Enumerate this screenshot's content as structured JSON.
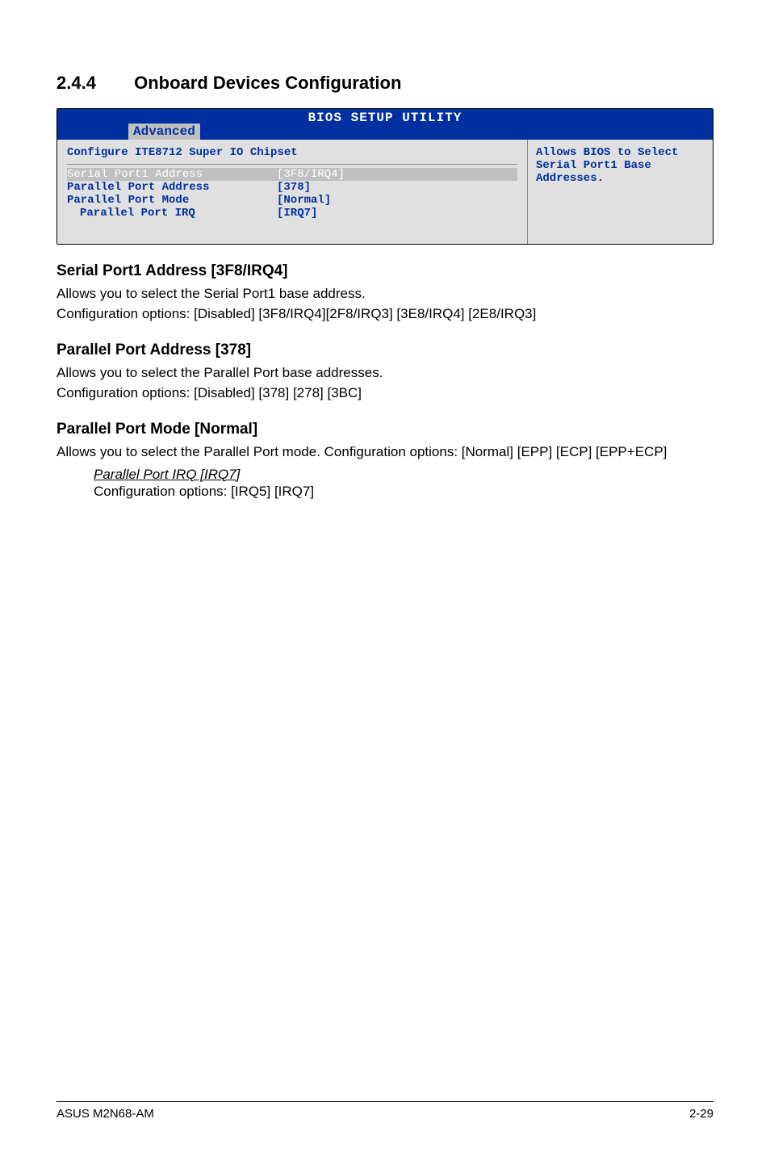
{
  "section": {
    "number": "2.4.4",
    "title": "Onboard Devices Configuration"
  },
  "bios": {
    "header_title": "BIOS SETUP UTILITY",
    "tab": "Advanced",
    "panel_title": "Configure ITE8712 Super IO Chipset",
    "help_text": "Allows BIOS to Select Serial Port1 Base Addresses.",
    "options": [
      {
        "label": "Serial Port1 Address",
        "value": "[3F8/IRQ4]",
        "selected": true,
        "indent": false
      },
      {
        "label": "Parallel Port Address",
        "value": "[378]",
        "selected": false,
        "indent": false
      },
      {
        "label": "Parallel Port Mode",
        "value": "[Normal]",
        "selected": false,
        "indent": false
      },
      {
        "label": "Parallel Port IRQ",
        "value": "[IRQ7]",
        "selected": false,
        "indent": true
      }
    ]
  },
  "sections": {
    "serial": {
      "heading": "Serial Port1 Address [3F8/IRQ4]",
      "line1": "Allows you to select the Serial Port1 base address.",
      "line2": "Configuration options: [Disabled] [3F8/IRQ4][2F8/IRQ3] [3E8/IRQ4] [2E8/IRQ3]"
    },
    "paddr": {
      "heading": "Parallel Port Address [378]",
      "line1": "Allows you to select the Parallel Port base addresses.",
      "line2": "Configuration options: [Disabled] [378] [278] [3BC]"
    },
    "pmode": {
      "heading": "Parallel Port Mode [Normal]",
      "line1": "Allows you to select the Parallel Port  mode. Configuration options: [Normal] [EPP] [ECP] [EPP+ECP]",
      "sub_heading": "Parallel Port IRQ [IRQ7]",
      "sub_line": "Configuration options: [IRQ5] [IRQ7]"
    }
  },
  "footer": {
    "left": "ASUS M2N68-AM",
    "right": "2-29"
  }
}
